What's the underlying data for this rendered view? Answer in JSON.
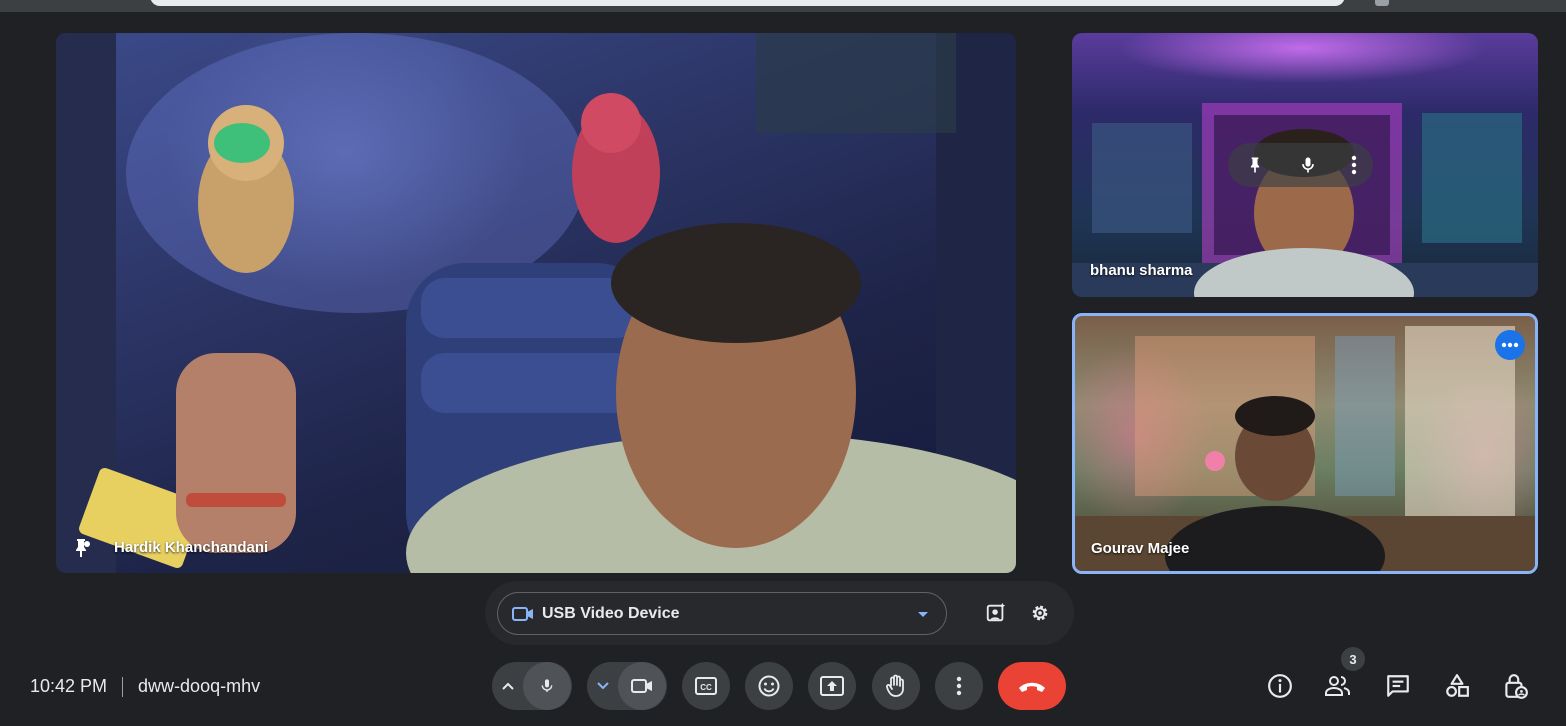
{
  "meeting": {
    "time": "10:42 PM",
    "code": "dww-dooq-mhv"
  },
  "participants": [
    {
      "name": "Hardik Khanchandani"
    },
    {
      "name": "bhanu sharma"
    },
    {
      "name": "Gourav Majee"
    }
  ],
  "device": {
    "selected": "USB Video Device"
  },
  "people_count": "3",
  "colors": {
    "background": "#202124",
    "hangup": "#ea4335",
    "accent": "#8ab4f8",
    "badge_blue": "#1a73e8"
  },
  "icons": {
    "controls": [
      "chevron-up-icon",
      "mic-icon",
      "chevron-down-icon",
      "camera-icon",
      "captions-icon",
      "emoji-icon",
      "present-icon",
      "raise-hand-icon",
      "more-vert-icon",
      "hangup-icon"
    ],
    "right": [
      "info-icon",
      "people-icon",
      "chat-icon",
      "activities-icon",
      "host-controls-icon"
    ]
  }
}
